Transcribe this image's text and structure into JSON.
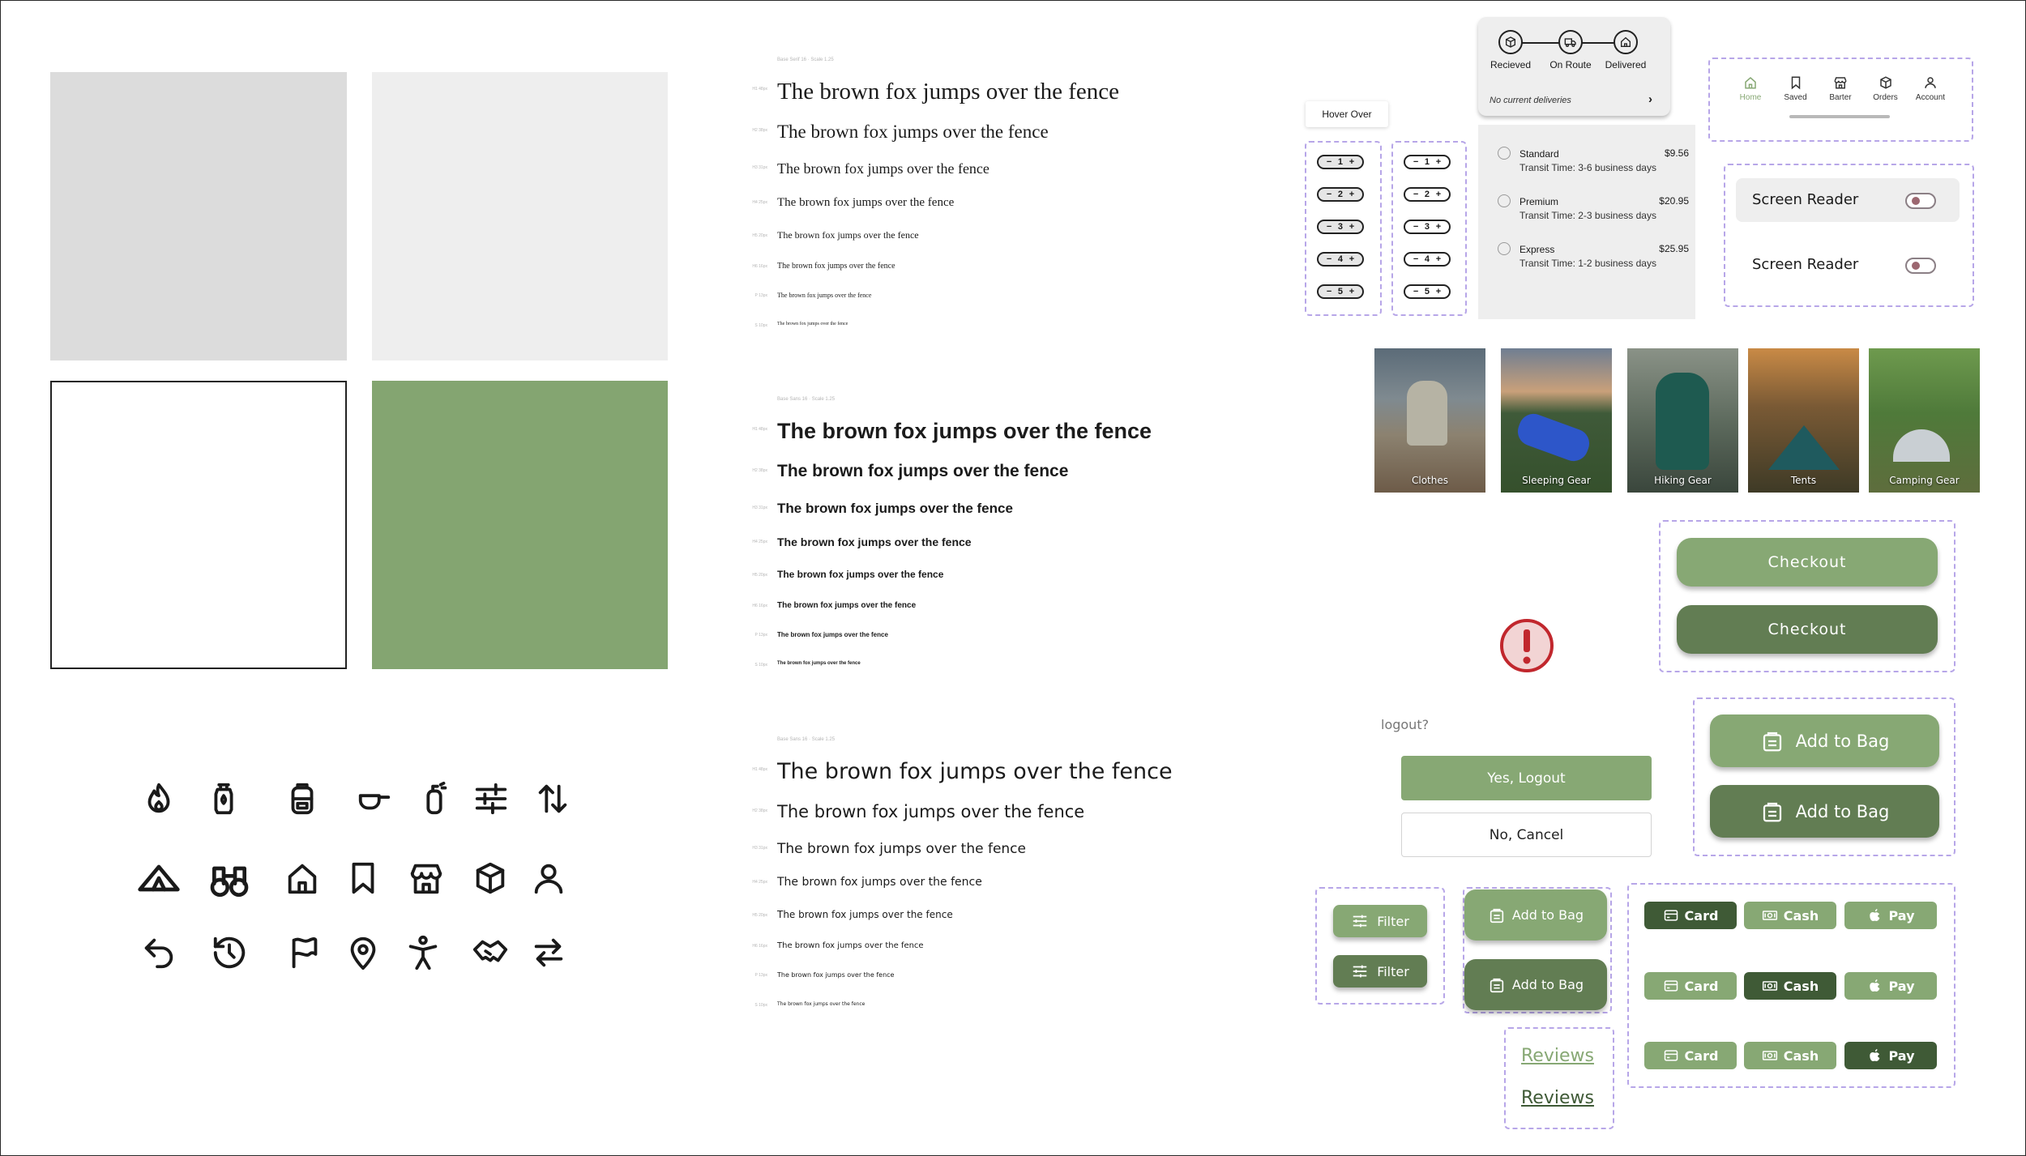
{
  "colors": {
    "swatch_light_gray": "#dcdcdc",
    "swatch_lighter_gray": "#eeeeee",
    "swatch_white": "#ffffff",
    "swatch_green": "#84a571",
    "green_light": "#87a874",
    "green_dark": "#627d53",
    "green_darkest": "#3f5a36",
    "alert_red": "#c1272d"
  },
  "type_specimen": {
    "serif": {
      "caption": "Base Serif 16 · Scale 1.25",
      "rows": [
        {
          "label": "H1 48px",
          "text": "The brown fox jumps over the fence"
        },
        {
          "label": "H2 38px",
          "text": "The brown fox jumps over the fence"
        },
        {
          "label": "H3 31px",
          "text": "The brown fox jumps over the fence"
        },
        {
          "label": "H4 25px",
          "text": "The brown fox jumps over the fence"
        },
        {
          "label": "H5 20px",
          "text": "The brown fox jumps over the fence"
        },
        {
          "label": "H6 16px",
          "text": "The brown fox jumps over the fence"
        },
        {
          "label": "P 13px",
          "text": "The brown fox jumps over the fence"
        },
        {
          "label": "S 10px",
          "text": "The brown fox jumps over the fence"
        }
      ]
    },
    "sans_bold": {
      "caption": "Base Sans 16 · Scale 1.25",
      "rows": [
        {
          "label": "H1 48px",
          "text": "The brown fox jumps over the fence"
        },
        {
          "label": "H2 38px",
          "text": "The brown fox jumps over the fence"
        },
        {
          "label": "H3 31px",
          "text": "The brown fox jumps over the fence"
        },
        {
          "label": "H4 25px",
          "text": "The brown fox jumps over the fence"
        },
        {
          "label": "H5 20px",
          "text": "The brown fox jumps over the fence"
        },
        {
          "label": "H6 16px",
          "text": "The brown fox jumps over the fence"
        },
        {
          "label": "P 13px",
          "text": "The brown fox jumps over the fence"
        },
        {
          "label": "S 10px",
          "text": "The brown fox jumps over the fence"
        }
      ]
    },
    "sans_regular": {
      "caption": "Base Sans 16 · Scale 1.25",
      "rows": [
        {
          "label": "H1 48px",
          "text": "The brown fox jumps over the fence"
        },
        {
          "label": "H2 38px",
          "text": "The brown fox jumps over the fence"
        },
        {
          "label": "H3 31px",
          "text": "The brown fox jumps over the fence"
        },
        {
          "label": "H4 25px",
          "text": "The brown fox jumps over the fence"
        },
        {
          "label": "H5 20px",
          "text": "The brown fox jumps over the fence"
        },
        {
          "label": "H6 16px",
          "text": "The brown fox jumps over the fence"
        },
        {
          "label": "P 13px",
          "text": "The brown fox jumps over the fence"
        },
        {
          "label": "S 10px",
          "text": "The brown fox jumps over the fence"
        }
      ]
    }
  },
  "icons": [
    "campfire-icon",
    "lantern-icon",
    "backpack-icon",
    "cooking-pot-icon",
    "gas-canister-icon",
    "sliders-icon",
    "sort-arrows-icon",
    "tent-icon",
    "binoculars-icon",
    "home-icon",
    "bookmark-icon",
    "store-icon",
    "box-icon",
    "user-icon",
    "undo-icon",
    "history-icon",
    "flag-icon",
    "location-pin-icon",
    "accessibility-icon",
    "handshake-icon",
    "swap-arrows-icon"
  ],
  "hover_tooltip": "Hover Over",
  "steppers": [
    "1",
    "2",
    "3",
    "4",
    "5"
  ],
  "stepper_minus": "−",
  "stepper_plus": "+",
  "delivery_tracker": {
    "steps": [
      "Recieved",
      "On Route",
      "Delivered"
    ],
    "status": "No current deliveries"
  },
  "shipping_options": [
    {
      "name": "Standard",
      "price": "$9.56",
      "transit": "Transit Time: 3-6 business days"
    },
    {
      "name": "Premium",
      "price": "$20.95",
      "transit": "Transit Time: 2-3 business days"
    },
    {
      "name": "Express",
      "price": "$25.95",
      "transit": "Transit Time: 1-2 business days"
    }
  ],
  "bottom_nav": [
    "Home",
    "Saved",
    "Barter",
    "Orders",
    "Account"
  ],
  "accessibility": {
    "label": "Screen Reader"
  },
  "categories": [
    "Clothes",
    "Sleeping Gear",
    "Hiking Gear",
    "Tents",
    "Camping Gear"
  ],
  "checkout_label": "Checkout",
  "logout": {
    "question": "logout?",
    "confirm": "Yes, Logout",
    "cancel": "No, Cancel"
  },
  "add_to_bag_label": "Add to Bag",
  "filter_label": "Filter",
  "payment": {
    "card": "Card",
    "cash": "Cash",
    "apple_pay": "Pay"
  },
  "reviews_label": "Reviews"
}
